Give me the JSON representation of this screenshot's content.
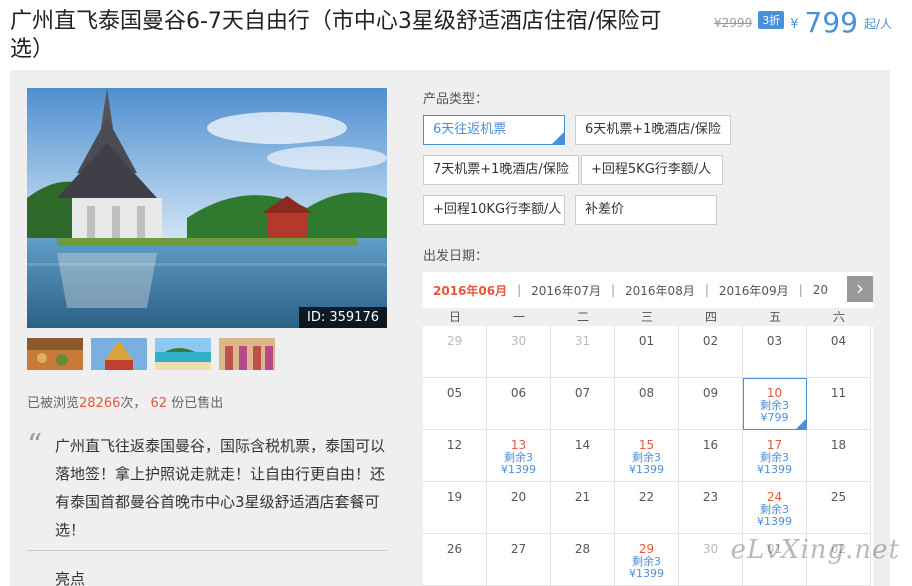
{
  "title": "广州直飞泰国曼谷6-7天自由行（市中心3星级舒适酒店住宿/保险可选）",
  "price": {
    "original": "¥2999",
    "discount": "3折",
    "currency": "¥",
    "amount": "799",
    "unit": "起/人"
  },
  "hero": {
    "id_label": "ID: 359176"
  },
  "stats": {
    "prefix": "已被浏览",
    "views": "28266",
    "mid": "次，",
    "sold": "62",
    "suffix": "份已售出"
  },
  "description": "广州直飞往返泰国曼谷，国际含税机票，泰国可以落地签！拿上护照说走就走！让自由行更自由！还有泰国首都曼谷首晚市中心3星级舒适酒店套餐可选！",
  "highlights_label": "亮点",
  "product_type": {
    "label": "产品类型：",
    "options": [
      "6天往返机票",
      "6天机票+1晚酒店/保险",
      "7天机票+1晚酒店/保险",
      "+回程5KG行李额/人",
      "+回程10KG行李额/人",
      "补差价"
    ]
  },
  "departure": {
    "label": "出发日期：",
    "months": [
      "2016年06月",
      "2016年07月",
      "2016年08月",
      "2016年09月",
      "20"
    ],
    "next_icon": "›",
    "weekdays": [
      "日",
      "一",
      "二",
      "三",
      "四",
      "五",
      "六"
    ],
    "days": [
      {
        "d": "29"
      },
      {
        "d": "30"
      },
      {
        "d": "31"
      },
      {
        "d": "01"
      },
      {
        "d": "02"
      },
      {
        "d": "03"
      },
      {
        "d": "04"
      },
      {
        "d": "05"
      },
      {
        "d": "06"
      },
      {
        "d": "07"
      },
      {
        "d": "08"
      },
      {
        "d": "09"
      },
      {
        "d": "10",
        "rem": "剩余3",
        "price": "¥799"
      },
      {
        "d": "11"
      },
      {
        "d": "12"
      },
      {
        "d": "13",
        "rem": "剩余3",
        "price": "¥1399"
      },
      {
        "d": "14"
      },
      {
        "d": "15",
        "rem": "剩余3",
        "price": "¥1399"
      },
      {
        "d": "16"
      },
      {
        "d": "17",
        "rem": "剩余3",
        "price": "¥1399"
      },
      {
        "d": "18"
      },
      {
        "d": "19"
      },
      {
        "d": "20"
      },
      {
        "d": "21"
      },
      {
        "d": "22"
      },
      {
        "d": "23"
      },
      {
        "d": "24",
        "rem": "剩余3",
        "price": "¥1399"
      },
      {
        "d": "25"
      },
      {
        "d": "26"
      },
      {
        "d": "27"
      },
      {
        "d": "28"
      },
      {
        "d": "29",
        "rem": "剩余3",
        "price": "¥1399"
      },
      {
        "d": "30"
      },
      {
        "d": "01"
      },
      {
        "d": "02"
      }
    ]
  },
  "watermark": "eLvXing.net",
  "colors": {
    "accent": "#4a90d9",
    "highlight": "#e6563a",
    "panel": "#efefef"
  }
}
